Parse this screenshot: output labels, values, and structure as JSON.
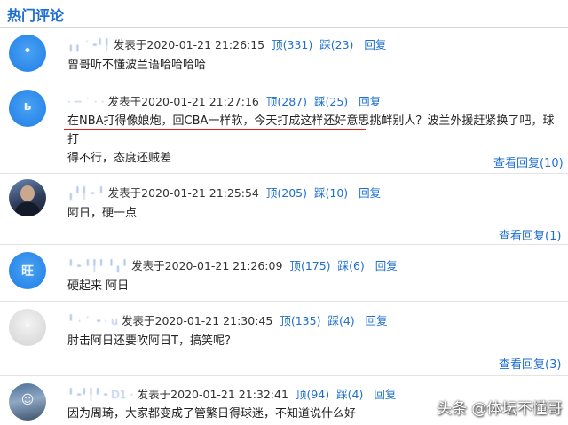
{
  "section": {
    "title": "热门评论"
  },
  "labels": {
    "posted_prefix": "发表于",
    "up": "顶",
    "down": "踩",
    "reply": "回复",
    "view_replies": "查看回复"
  },
  "comments": [
    {
      "user": "╻╻ ˙╺╹╿",
      "time": "2020-01-21  21:26:15",
      "up": "(331)",
      "down": "(23)",
      "lines": [
        "曾哥听不懂波兰语哈哈哈哈"
      ],
      "replies": ""
    },
    {
      "user": "·  ─  ˙  ·  ·",
      "time": "2020-01-21  21:27:16",
      "up": "(287)",
      "down": "(25)",
      "lines": [
        "在NBA打得像娘炮，回CBA一样软，今天打成这样还好意思挑衅别人？波兰外援赶紧换了吧，球打",
        "得不行，态度还贼差"
      ],
      "replies": "(10)"
    },
    {
      "user": "╻╹╿╺ ╹",
      "time": "2020-01-21  21:25:54",
      "up": "(205)",
      "down": "(10)",
      "lines": [
        "阿日，硬一点"
      ],
      "replies": "(1)"
    },
    {
      "user": "╹╺ ╹╿╹ ╹╻╹",
      "time": "2020-01-21  21:26:09",
      "up": "(175)",
      "down": "(6)",
      "lines": [
        "硬起来 阿日"
      ],
      "replies": ""
    },
    {
      "user": "╹  · ˙ ╺ ·  u",
      "time": "2020-01-21  21:30:45",
      "up": "(135)",
      "down": "(4)",
      "lines": [
        "肘击阿日还要吹阿日T，搞笑呢？"
      ],
      "replies": "(3)"
    },
    {
      "user": "╹╺╹╿╹╺ D1 ·",
      "time": "2020-01-21  21:32:41",
      "up": "(94)",
      "down": "(4)",
      "lines": [
        "因为周琦，大家都变成了管繁日得球迷，不知道说什么好"
      ],
      "replies": ""
    }
  ],
  "watermark": "头条 @体坛不懂哥"
}
